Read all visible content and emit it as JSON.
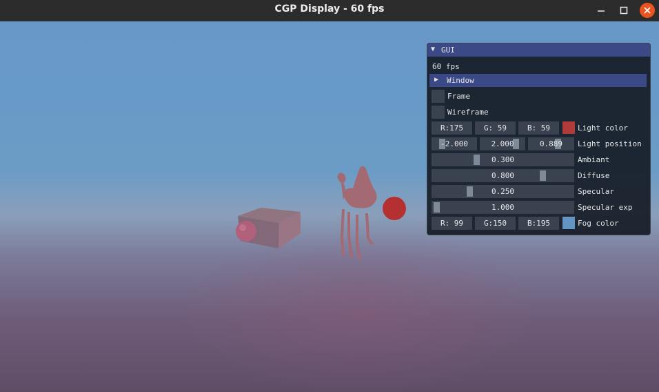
{
  "window": {
    "title": "CGP Display - 60 fps"
  },
  "window_controls": {
    "minimize": "—",
    "maximize": "☐",
    "close": "✕"
  },
  "gui": {
    "title": "GUI",
    "fps": "60 fps",
    "window_node": "Window",
    "frame_label": "Frame",
    "frame_checked": false,
    "wireframe_label": "Wireframe",
    "wireframe_checked": false,
    "light_color": {
      "r": "R:175",
      "g": "G: 59",
      "b": "B: 59",
      "label": "Light color",
      "hex": "#af3b3b"
    },
    "light_position": {
      "x": "-2.000",
      "y": "2.000",
      "z": "0.889",
      "label": "Light position"
    },
    "ambiant": {
      "value": "0.300",
      "label": "Ambiant",
      "fraction": 0.3
    },
    "diffuse": {
      "value": "0.800",
      "label": "Diffuse",
      "fraction": 0.8
    },
    "specular": {
      "value": "0.250",
      "label": "Specular",
      "fraction": 0.25
    },
    "specular_exp": {
      "value": "1.000",
      "label": "Specular exp",
      "fraction": 0.0
    },
    "fog_color": {
      "r": "R: 99",
      "g": "G:150",
      "b": "B:195",
      "label": "Fog color",
      "hex": "#6396c3"
    }
  },
  "scene": {
    "sky_color": "#6798c8",
    "ground_color": "#6e5d7a",
    "cube_color": "#8c6a78",
    "sphere_small_color": "#b0607a",
    "sphere_red_color": "#b53131",
    "camel_color": "#a36a73"
  }
}
